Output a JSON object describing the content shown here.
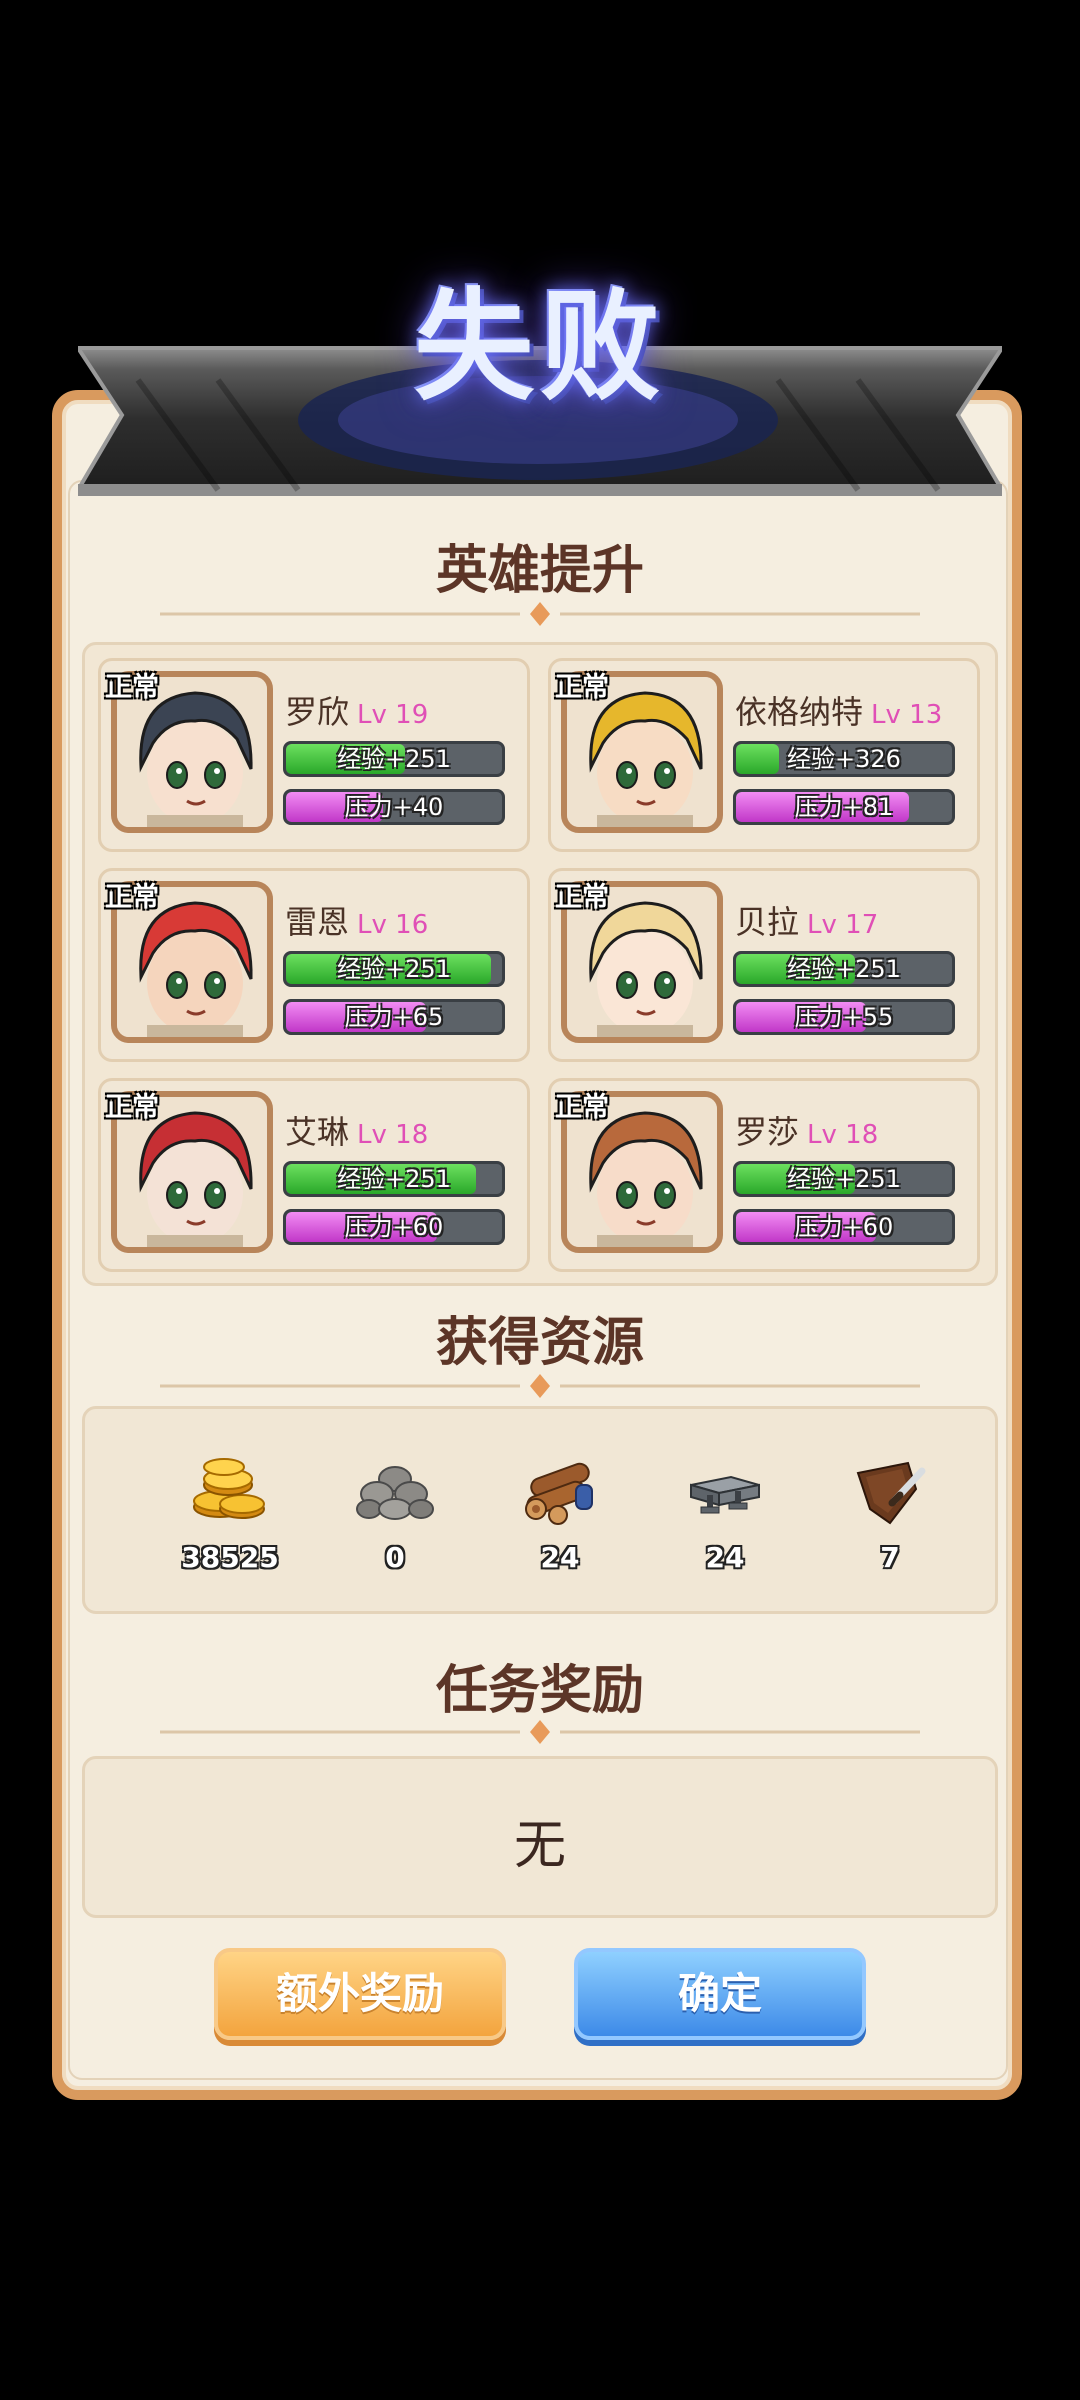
{
  "title": "失败",
  "sections": {
    "hero_upgrade": "英雄提升",
    "resources": "获得资源",
    "task_reward": "任务奖励"
  },
  "heroes": [
    {
      "state": "正常",
      "name": "罗欣",
      "level": "Lv 19",
      "exp_label": "经验+251",
      "pressure_label": "压力+40",
      "exp_fill": 0.55,
      "pressure_fill": 0.45,
      "hair": "#3b4453",
      "skin": "#f7e0cf"
    },
    {
      "state": "正常",
      "name": "依格纳特",
      "level": "Lv 13",
      "exp_label": "经验+326",
      "pressure_label": "压力+81",
      "exp_fill": 0.2,
      "pressure_fill": 0.8,
      "hair": "#e6b72c",
      "skin": "#f7dcc4"
    },
    {
      "state": "正常",
      "name": "雷恩",
      "level": "Lv 16",
      "exp_label": "经验+251",
      "pressure_label": "压力+65",
      "exp_fill": 0.95,
      "pressure_fill": 0.65,
      "hair": "#d83a36",
      "skin": "#f5d5bd"
    },
    {
      "state": "正常",
      "name": "贝拉",
      "level": "Lv 17",
      "exp_label": "经验+251",
      "pressure_label": "压力+55",
      "exp_fill": 0.55,
      "pressure_fill": 0.6,
      "hair": "#f0d79a",
      "skin": "#fae6d6"
    },
    {
      "state": "正常",
      "name": "艾琳",
      "level": "Lv 18",
      "exp_label": "经验+251",
      "pressure_label": "压力+60",
      "exp_fill": 0.88,
      "pressure_fill": 0.7,
      "hair": "#c62f34",
      "skin": "#f4e2d6"
    },
    {
      "state": "正常",
      "name": "罗莎",
      "level": "Lv 18",
      "exp_label": "经验+251",
      "pressure_label": "压力+60",
      "exp_fill": 0.55,
      "pressure_fill": 0.65,
      "hair": "#b8693c",
      "skin": "#f7dcc9"
    }
  ],
  "resources": [
    {
      "icon": "gold-coins-icon",
      "count": "38525"
    },
    {
      "icon": "stone-icon",
      "count": "0"
    },
    {
      "icon": "wood-logs-icon",
      "count": "24"
    },
    {
      "icon": "iron-ingot-icon",
      "count": "24"
    },
    {
      "icon": "leather-icon",
      "count": "7"
    }
  ],
  "task": {
    "value": "无"
  },
  "buttons": {
    "extra": "额外奖励",
    "confirm": "确定"
  }
}
